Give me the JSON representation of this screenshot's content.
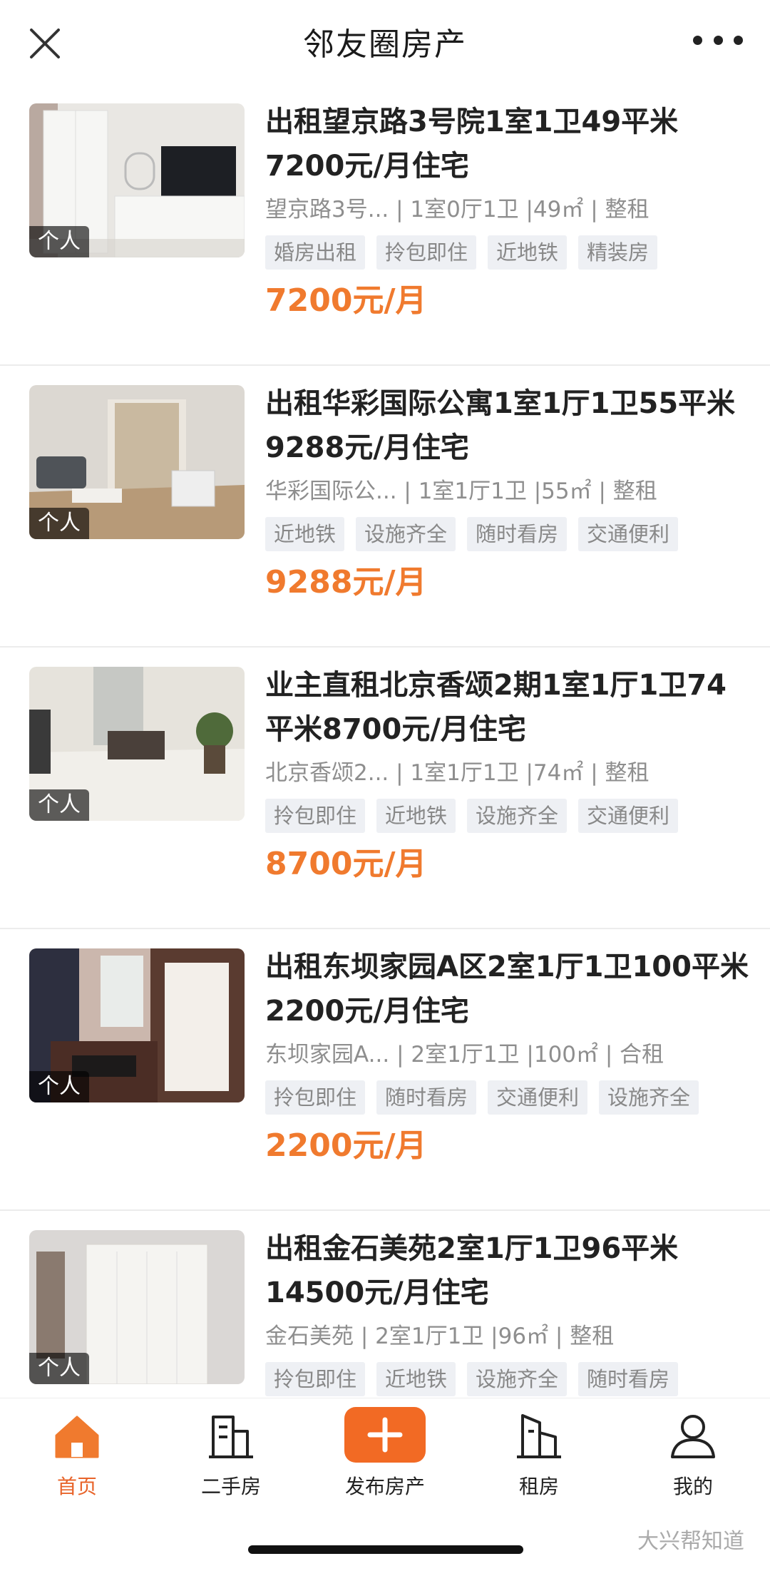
{
  "header": {
    "title": "邻友圈房产"
  },
  "listings": [
    {
      "title": "出租望京路3号院1室1卫49平米7200元/月住宅",
      "meta": "望京路3号... | 1室0厅1卫 |49㎡ | 整租",
      "tags": [
        "婚房出租",
        "拎包即住",
        "近地铁",
        "精装房"
      ],
      "price": "7200元/月",
      "badge": "个人"
    },
    {
      "title": "出租华彩国际公寓1室1厅1卫55平米9288元/月住宅",
      "meta": "华彩国际公... | 1室1厅1卫 |55㎡ | 整租",
      "tags": [
        "近地铁",
        "设施齐全",
        "随时看房",
        "交通便利"
      ],
      "price": "9288元/月",
      "badge": "个人"
    },
    {
      "title": "业主直租北京香颂2期1室1厅1卫74平米8700元/月住宅",
      "meta": "北京香颂2... | 1室1厅1卫 |74㎡ | 整租",
      "tags": [
        "拎包即住",
        "近地铁",
        "设施齐全",
        "交通便利"
      ],
      "price": "8700元/月",
      "badge": "个人"
    },
    {
      "title": "出租东坝家园A区2室1厅1卫100平米2200元/月住宅",
      "meta": "东坝家园A... | 2室1厅1卫 |100㎡ | 合租",
      "tags": [
        "拎包即住",
        "随时看房",
        "交通便利",
        "设施齐全"
      ],
      "price": "2200元/月",
      "badge": "个人"
    },
    {
      "title": "出租金石美苑2室1厅1卫96平米14500元/月住宅",
      "meta": "金石美苑 | 2室1厅1卫 |96㎡ | 整租",
      "tags": [
        "拎包即住",
        "近地铁",
        "设施齐全",
        "随时看房"
      ],
      "price": "",
      "badge": "个人"
    }
  ],
  "tabs": [
    {
      "label": "首页",
      "icon": "home-icon"
    },
    {
      "label": "二手房",
      "icon": "building-icon"
    },
    {
      "label": "发布房产",
      "icon": "plus-icon"
    },
    {
      "label": "租房",
      "icon": "tower-icon"
    },
    {
      "label": "我的",
      "icon": "user-icon"
    }
  ],
  "watermark": "大兴帮知道",
  "colors": {
    "accent": "#f07a2e",
    "tab_active": "#e8642a",
    "tag_bg": "#eef0f4"
  }
}
